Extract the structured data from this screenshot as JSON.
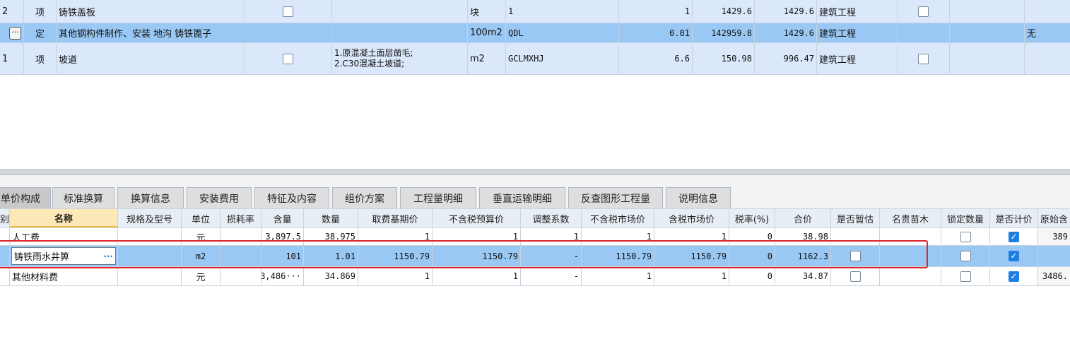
{
  "upper_table": {
    "rows": [
      {
        "seq": "2",
        "type": "项",
        "name": "铸铁盖板",
        "spec": "",
        "unit": "块",
        "expr": "1",
        "ratio": "1",
        "price": "1429.6",
        "total": "1429.6",
        "category": "建筑工程",
        "last": ""
      },
      {
        "seq": "",
        "type": "定",
        "name": "其他钢构件制作、安装 地沟 铸铁篦子",
        "spec": "",
        "unit": "100m2",
        "expr": "QDL",
        "ratio": "0.01",
        "price": "142959.8",
        "total": "1429.6",
        "category": "建筑工程",
        "last": "无"
      },
      {
        "seq": "1",
        "type": "项",
        "name": "坡道",
        "spec_line1": "1.原混凝土面层凿毛;",
        "spec_line2": "2.C30混凝土坡道;",
        "unit": "m2",
        "expr": "GCLMXHJ",
        "ratio": "6.6",
        "price": "150.98",
        "total": "996.47",
        "category": "建筑工程",
        "last": ""
      }
    ],
    "ellipsis_button": "···"
  },
  "tabs": [
    "单价构成",
    "标准换算",
    "换算信息",
    "安装费用",
    "特征及内容",
    "组价方案",
    "工程量明细",
    "垂直运输明细",
    "反查图形工程量",
    "说明信息"
  ],
  "lower_table": {
    "headers": [
      "别",
      "名称",
      "规格及型号",
      "单位",
      "损耗率",
      "含量",
      "数量",
      "取费基期价",
      "不含税预算价",
      "调整系数",
      "不含税市场价",
      "含税市场价",
      "税率(%)",
      "合价",
      "是否暂估",
      "名贵苗木",
      "锁定数量",
      "是否计价",
      "原始含"
    ],
    "rows": [
      {
        "name": "人工费",
        "unit": "元",
        "content": "3,897.5",
        "qty": "38.975",
        "base": "1",
        "budget": "1",
        "adjust": "1",
        "market": "1",
        "market_tax": "1",
        "tax": "0",
        "total": "38.98",
        "priced": true,
        "orig": "389"
      },
      {
        "name": "铸铁雨水井箅",
        "unit": "m2",
        "content": "101",
        "qty": "1.01",
        "base": "1150.79",
        "budget": "1150.79",
        "adjust": "-",
        "market": "1150.79",
        "market_tax": "1150.79",
        "tax": "0",
        "total": "1162.3",
        "priced": true,
        "orig": ""
      },
      {
        "name": "其他材料费",
        "unit": "元",
        "content": "3,486···",
        "qty": "34.869",
        "base": "1",
        "budget": "1",
        "adjust": "-",
        "market": "1",
        "market_tax": "1",
        "tax": "0",
        "total": "34.87",
        "priced": true,
        "orig": "3486."
      }
    ],
    "ellipsis_button": "···"
  },
  "colors": {
    "row_light": "#dbe8fb",
    "row_selected": "#99c8f5",
    "header_bg": "#e8eef5",
    "highlight_border": "#e0242c",
    "name_header_bg": "#fde9b8"
  }
}
